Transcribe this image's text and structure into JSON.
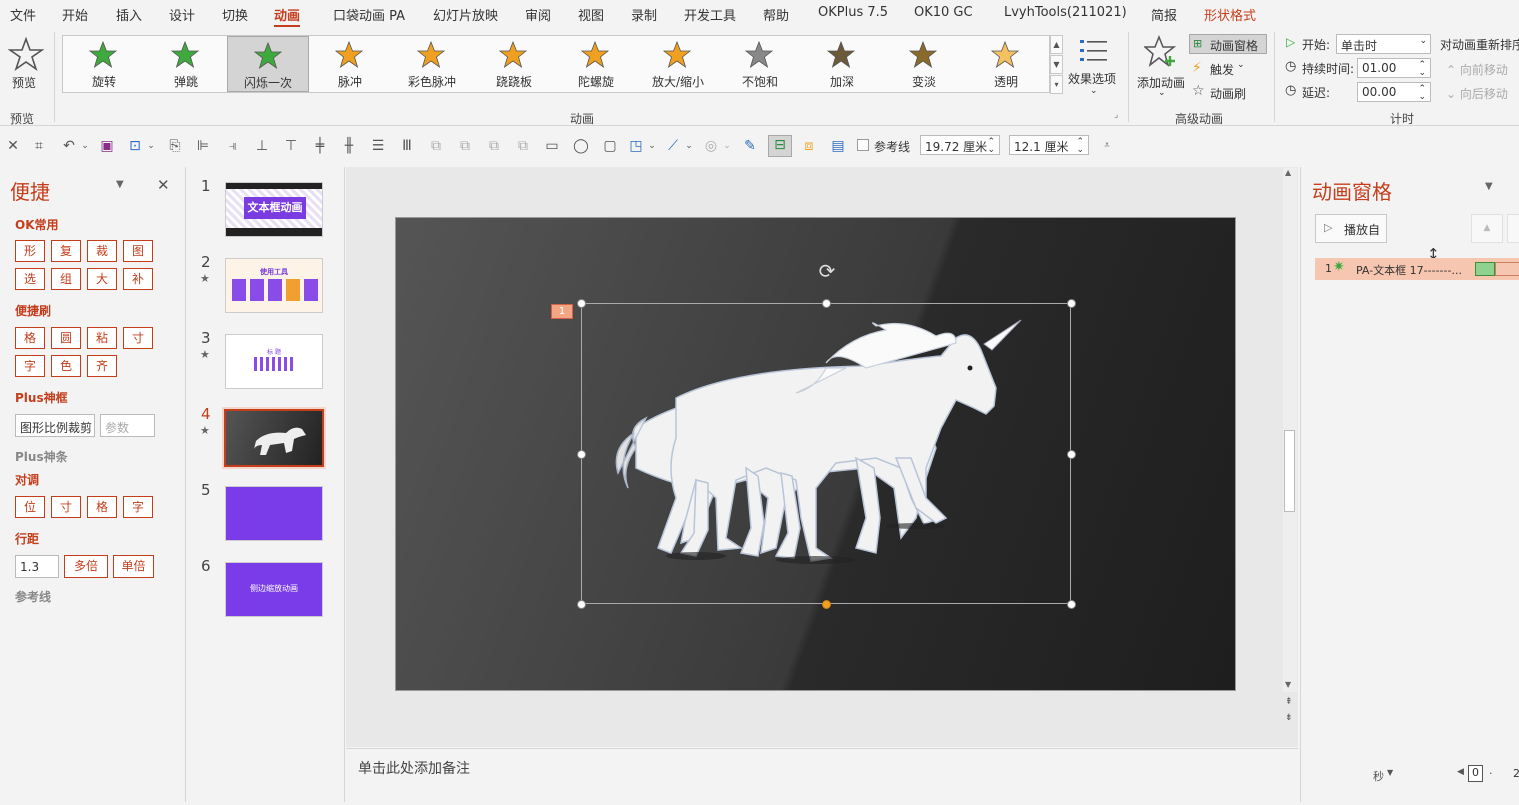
{
  "menu": {
    "items": [
      "文件",
      "开始",
      "插入",
      "设计",
      "切换",
      "动画",
      "口袋动画 PA",
      "幻灯片放映",
      "审阅",
      "视图",
      "录制",
      "开发工具",
      "帮助",
      "OKPlus 7.5",
      "OK10 GC",
      "LvyhTools(211021)",
      "简报",
      "形状格式"
    ],
    "active": "动画"
  },
  "ribbon": {
    "preview_label": "预览",
    "preview_group": "预览",
    "animation_group": "动画",
    "advanced_group": "高级动画",
    "timing_group": "计时",
    "gallery": [
      {
        "label": "旋转",
        "color": "#3eaa3e"
      },
      {
        "label": "弹跳",
        "color": "#3eaa3e"
      },
      {
        "label": "闪烁一次",
        "color": "#3eaa3e",
        "selected": true
      },
      {
        "label": "脉冲",
        "color": "#f0a020"
      },
      {
        "label": "彩色脉冲",
        "color": "#f0a020"
      },
      {
        "label": "跷跷板",
        "color": "#f0a020"
      },
      {
        "label": "陀螺旋",
        "color": "#f0a020"
      },
      {
        "label": "放大/缩小",
        "color": "#f0a020"
      },
      {
        "label": "不饱和",
        "color": "#888888"
      },
      {
        "label": "加深",
        "color": "#6b5a3a"
      },
      {
        "label": "变淡",
        "color": "#8a6a2a"
      },
      {
        "label": "透明",
        "color": "#f4c060"
      }
    ],
    "effect_options": "效果选项",
    "add_animation": "添加动画",
    "anim_pane": "动画窗格",
    "trigger": "触发",
    "anim_brush": "动画刷",
    "start_label": "开始:",
    "start_value": "单击时",
    "duration_label": "持续时间:",
    "duration_value": "01.00",
    "delay_label": "延迟:",
    "delay_value": "00.00",
    "reorder_label": "对动画重新排序",
    "move_earlier": "向前移动",
    "move_later": "向后移动"
  },
  "toolbar2": {
    "guide_label": "参考线",
    "width_value": "19.72 厘米",
    "height_value": "12.1 厘米"
  },
  "left_panel": {
    "title": "便捷",
    "sec_ok": "OK常用",
    "ok_btns": [
      "形",
      "复",
      "裁",
      "图",
      "选",
      "组",
      "大",
      "补"
    ],
    "sec_brush": "便捷刷",
    "brush_btns": [
      "格",
      "圆",
      "粘",
      "寸",
      "字",
      "色",
      "齐"
    ],
    "sec_plus": "Plus神框",
    "crop_input": "图形比例裁剪",
    "param_placeholder": "参数",
    "sec_plus_bar": "Plus神条",
    "sec_align": "对调",
    "align_btns": [
      "位",
      "寸",
      "格",
      "字"
    ],
    "sec_spacing": "行距",
    "spacing_value": "1.3",
    "multi_btn": "多倍",
    "single_btn": "单倍",
    "sec_guide": "参考线"
  },
  "thumbnails": [
    {
      "num": "1",
      "star": false,
      "text": "文本框动画"
    },
    {
      "num": "2",
      "star": true,
      "text": "使用工具"
    },
    {
      "num": "3",
      "star": true,
      "text": "标 题"
    },
    {
      "num": "4",
      "star": true,
      "text": "",
      "selected": true
    },
    {
      "num": "5",
      "star": false,
      "text": ""
    },
    {
      "num": "6",
      "star": false,
      "text": "侧边缩放动画"
    }
  ],
  "slide": {
    "anim_tag": "1"
  },
  "notes_placeholder": "单击此处添加备注",
  "right_panel": {
    "title": "动画窗格",
    "play_button": "播放自",
    "item_num": "1",
    "item_label": "PA-文本框 17-------...",
    "seconds_label": "秒",
    "timeline_start": "0",
    "timeline_next": "2"
  }
}
